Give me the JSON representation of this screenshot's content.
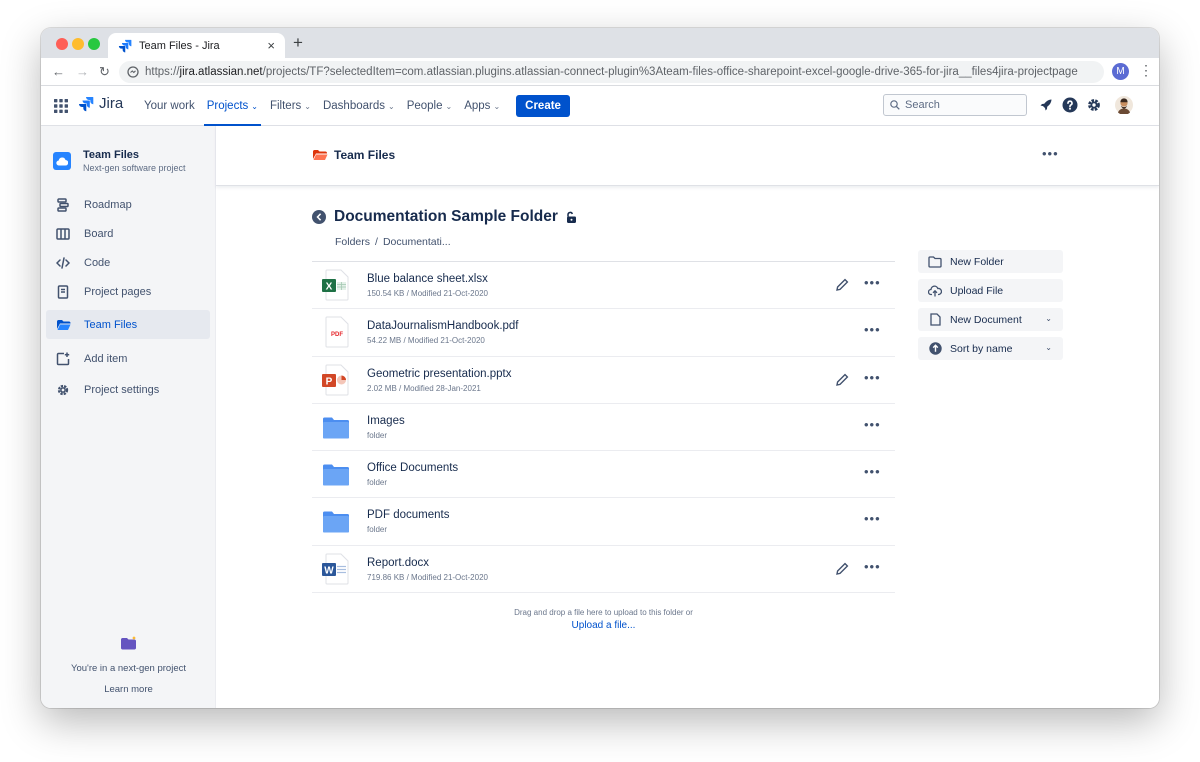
{
  "browser": {
    "tab_title": "Team Files - Jira",
    "tab_close": "×",
    "new_tab": "+",
    "url_prefix": "https://",
    "url_host": "jira.atlassian.net",
    "url_path": "/projects/TF?selectedItem=com.atlassian.plugins.atlassian-connect-plugin%3Ateam-files-office-sharepoint-excel-google-drive-365-for-jira__files4jira-projectpage",
    "profile_initial": "M"
  },
  "topnav": {
    "brand": "Jira",
    "links": [
      {
        "label": "Your work",
        "dropdown": false,
        "active": false
      },
      {
        "label": "Projects",
        "dropdown": true,
        "active": true
      },
      {
        "label": "Filters",
        "dropdown": true,
        "active": false
      },
      {
        "label": "Dashboards",
        "dropdown": true,
        "active": false
      },
      {
        "label": "People",
        "dropdown": true,
        "active": false
      },
      {
        "label": "Apps",
        "dropdown": true,
        "active": false
      }
    ],
    "create_label": "Create",
    "search_placeholder": "Search"
  },
  "sidebar": {
    "project_name": "Team Files",
    "project_type": "Next-gen software project",
    "items": [
      {
        "label": "Roadmap",
        "icon": "roadmap-icon"
      },
      {
        "label": "Board",
        "icon": "board-icon"
      },
      {
        "label": "Code",
        "icon": "code-icon"
      },
      {
        "label": "Project pages",
        "icon": "pages-icon"
      },
      {
        "label": "Team Files",
        "icon": "team-files-icon",
        "active": true
      },
      {
        "label": "Add item",
        "icon": "add-item-icon"
      },
      {
        "label": "Project settings",
        "icon": "gear-icon"
      }
    ],
    "footer_text": "You're in a next-gen project",
    "learn_more": "Learn more"
  },
  "main": {
    "header_title": "Team Files",
    "folder_title": "Documentation Sample Folder",
    "breadcrumb": [
      "Folders",
      "Documentati..."
    ],
    "breadcrumb_sep": "/",
    "files": [
      {
        "name": "Blue balance sheet.xlsx",
        "meta": "150.54 KB / Modified 21-Oct-2020",
        "type": "excel",
        "editable": true
      },
      {
        "name": "DataJournalismHandbook.pdf",
        "meta": "54.22 MB / Modified 21-Oct-2020",
        "type": "pdf",
        "editable": false
      },
      {
        "name": "Geometric presentation.pptx",
        "meta": "2.02 MB / Modified 28-Jan-2021",
        "type": "powerpoint",
        "editable": true
      },
      {
        "name": "Images",
        "meta": "folder",
        "type": "folder",
        "editable": false
      },
      {
        "name": "Office Documents",
        "meta": "folder",
        "type": "folder",
        "editable": false
      },
      {
        "name": "PDF documents",
        "meta": "folder",
        "type": "folder",
        "editable": false
      },
      {
        "name": "Report.docx",
        "meta": "719.86 KB / Modified 21-Oct-2020",
        "type": "word",
        "editable": true
      }
    ],
    "dropzone_text": "Drag and drop a file here to upload to this folder or",
    "dropzone_link": "Upload a file...",
    "actions": [
      {
        "label": "New Folder",
        "icon": "new-folder-icon",
        "dropdown": false
      },
      {
        "label": "Upload File",
        "icon": "upload-cloud-icon",
        "dropdown": false
      },
      {
        "label": "New Document",
        "icon": "document-icon",
        "dropdown": true
      },
      {
        "label": "Sort by name",
        "icon": "sort-icon",
        "dropdown": true
      }
    ]
  },
  "colors": {
    "accent": "#0052cc",
    "sidebar_bg": "#f4f5f7",
    "excel": "#1e7145",
    "powerpoint": "#d24726",
    "word": "#2b579a",
    "pdf": "#e5252a",
    "folder": "#5e9cf0",
    "team_files_orange": "#ff5630"
  }
}
